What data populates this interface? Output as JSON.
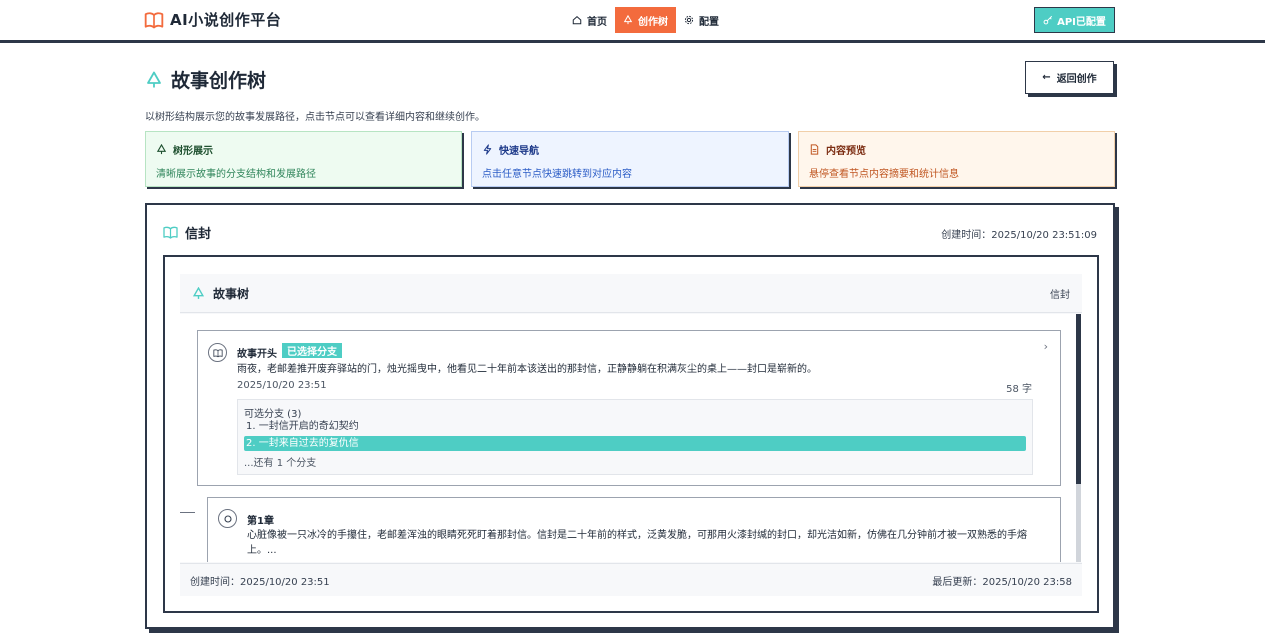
{
  "nav": {
    "brand": "AI小说创作平台",
    "items": [
      {
        "label": "首页",
        "icon": "home-icon",
        "active": false
      },
      {
        "label": "创作树",
        "icon": "tree-icon",
        "active": true
      },
      {
        "label": "配置",
        "icon": "gear-icon",
        "active": false
      }
    ],
    "api_label": "API已配置"
  },
  "page": {
    "title": "故事创作树",
    "back_label": "返回创作",
    "description": "以树形结构展示您的故事发展路径，点击节点可以查看详细内容和继续创作。"
  },
  "features": [
    {
      "title": "树形展示",
      "desc": "清晰展示故事的分支结构和发展路径",
      "icon": "tree-icon"
    },
    {
      "title": "快速导航",
      "desc": "点击任意节点快速跳转到对应内容",
      "icon": "lightning-icon"
    },
    {
      "title": "内容预览",
      "desc": "悬停查看节点内容摘要和统计信息",
      "icon": "document-icon"
    }
  ],
  "story": {
    "title": "信封",
    "created": "创建时间：2025/10/20 23:51:09",
    "tree_title": "故事树",
    "tree_story_name": "信封",
    "nodes": [
      {
        "title": "故事开头",
        "badge": "已选择分支",
        "text": "雨夜，老邮差推开废弃驿站的门，烛光摇曳中，他看见二十年前本该送出的那封信，正静静躺在积满灰尘的桌上——封口是崭新的。",
        "date": "2025/10/20 23:51",
        "words": "58 字",
        "branches_title": "可选分支 (3)",
        "branches": [
          "1. 一封信开启的奇幻契约",
          "2. 一封来自过去的复仇信"
        ],
        "branches_more": "...还有 1 个分支"
      },
      {
        "title": "第1章",
        "text": "心脏像被一只冰冷的手攥住，老邮差浑浊的眼睛死死盯着那封信。信封是二十年前的样式，泛黄发脆，可那用火漆封缄的封口，却光洁如新，仿佛在几分钟前才被一双熟悉的手熔上。..."
      }
    ],
    "footer_created": "创建时间：2025/10/20 23:51",
    "footer_updated": "最后更新：2025/10/20 23:58"
  },
  "colors": {
    "accent": "#4ecdc4",
    "active_nav": "#f36b3d",
    "border": "#2d3748"
  }
}
